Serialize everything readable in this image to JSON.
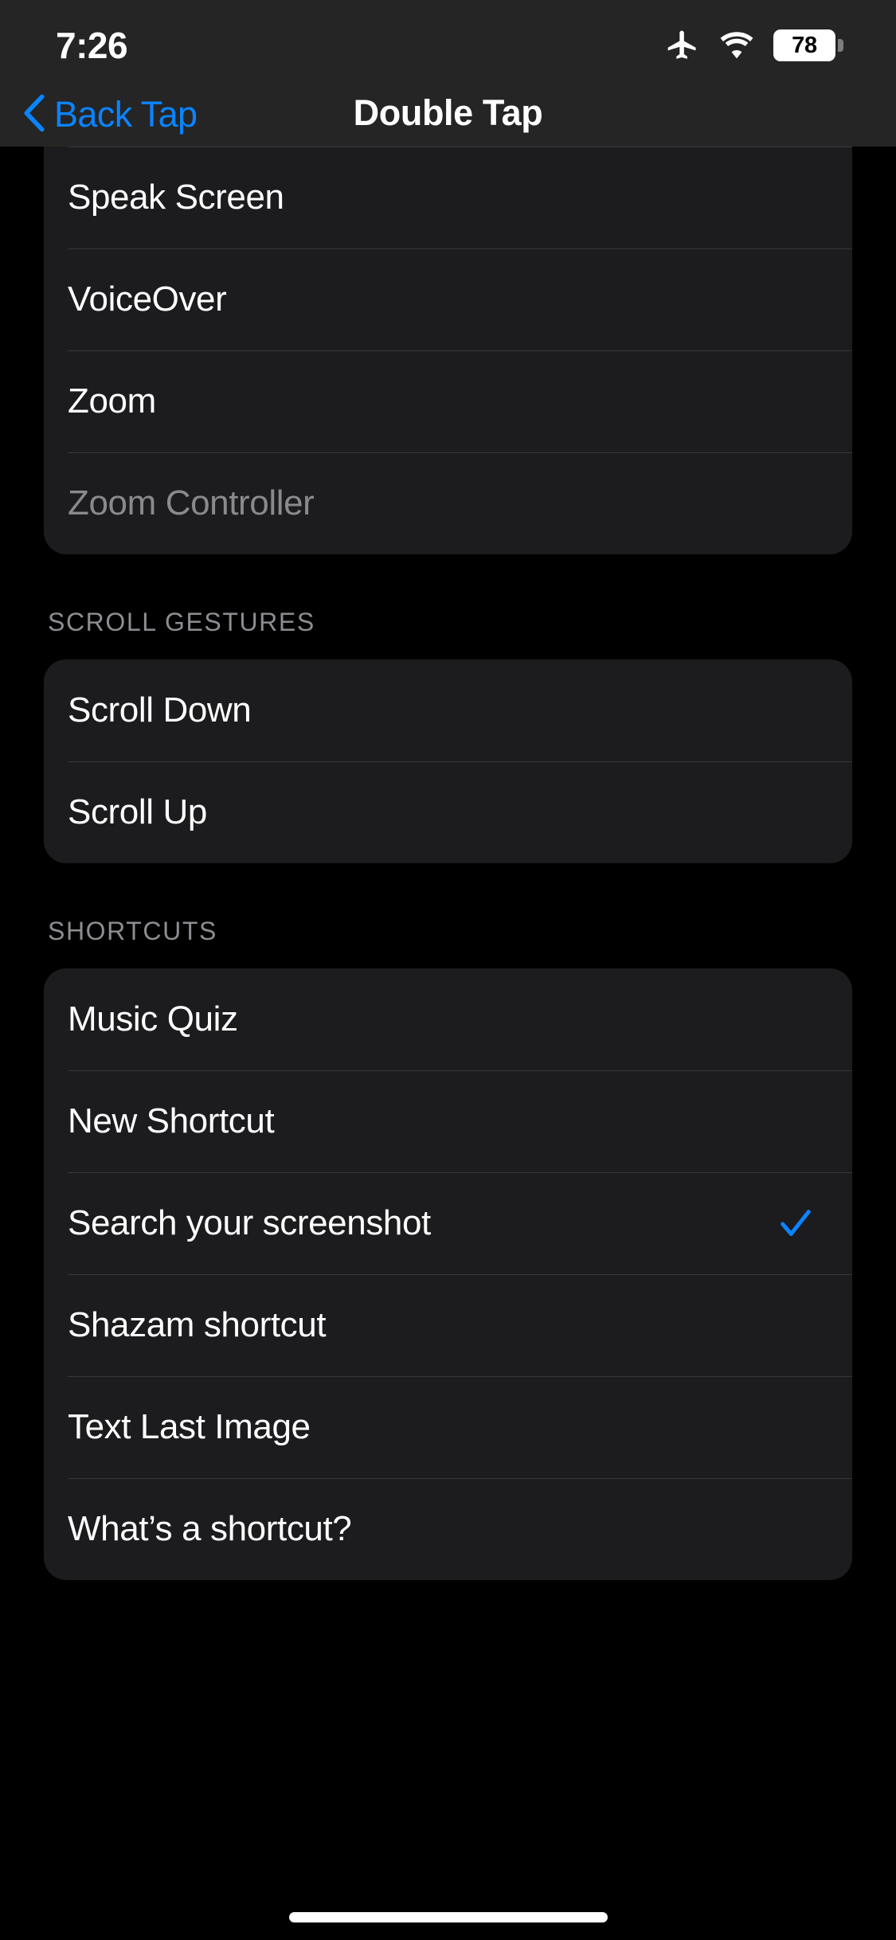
{
  "status_bar": {
    "time": "7:26",
    "airplane_icon": "airplane-mode-icon",
    "wifi_icon": "wifi-icon",
    "battery_level": "78",
    "battery_icon": "battery-icon"
  },
  "nav_bar": {
    "back_label": "Back Tap",
    "back_icon": "chevron-left-icon",
    "title": "Double Tap"
  },
  "colors": {
    "accent_blue": "#0a84ff",
    "card_background": "#1c1c1e",
    "page_background": "#000000",
    "separator": "#38383a",
    "disabled_text": "#8a8a8e",
    "header_text": "#8d8d92"
  },
  "sections": [
    {
      "header": null,
      "clipped_top": true,
      "rows": [
        {
          "label": "Speak Screen",
          "selected": false,
          "disabled": false
        },
        {
          "label": "VoiceOver",
          "selected": false,
          "disabled": false
        },
        {
          "label": "Zoom",
          "selected": false,
          "disabled": false
        },
        {
          "label": "Zoom Controller",
          "selected": false,
          "disabled": true
        }
      ]
    },
    {
      "header": "SCROLL GESTURES",
      "clipped_top": false,
      "rows": [
        {
          "label": "Scroll Down",
          "selected": false,
          "disabled": false
        },
        {
          "label": "Scroll Up",
          "selected": false,
          "disabled": false
        }
      ]
    },
    {
      "header": "SHORTCUTS",
      "clipped_top": false,
      "rows": [
        {
          "label": "Music Quiz",
          "selected": false,
          "disabled": false
        },
        {
          "label": "New Shortcut",
          "selected": false,
          "disabled": false
        },
        {
          "label": "Search your screenshot",
          "selected": true,
          "disabled": false
        },
        {
          "label": "Shazam shortcut",
          "selected": false,
          "disabled": false
        },
        {
          "label": "Text Last Image",
          "selected": false,
          "disabled": false
        },
        {
          "label": "What’s a shortcut?",
          "selected": false,
          "disabled": false
        }
      ]
    }
  ],
  "home_indicator": "home-indicator"
}
